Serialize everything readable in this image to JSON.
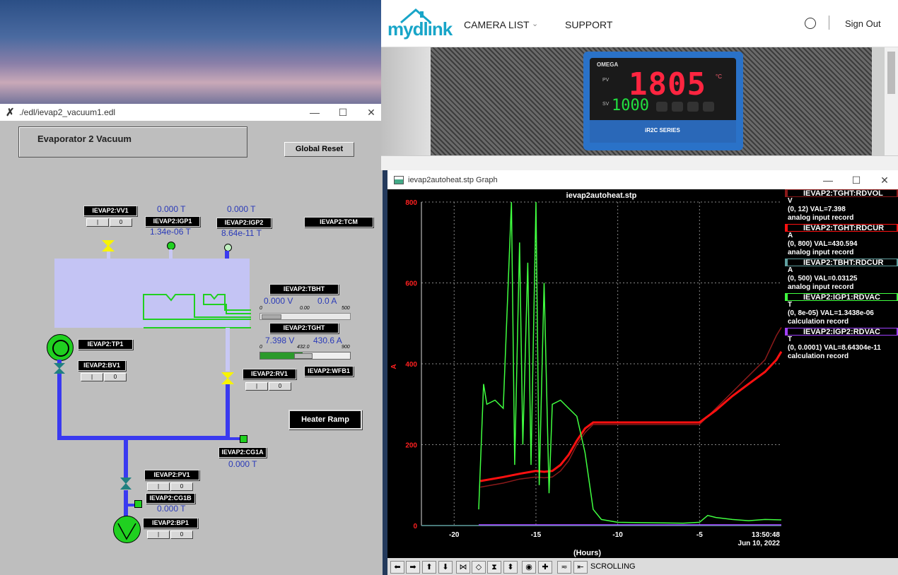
{
  "edm": {
    "title": "./edl/ievap2_vacuum1.edl",
    "panel_title": "Evaporator 2 Vacuum",
    "global_reset": "Global Reset",
    "heater_ramp": "Heater Ramp",
    "labels": {
      "vv1": "IEVAP2:VV1",
      "igp1": "IEVAP2:IGP1",
      "igp2": "IEVAP2:IGP2",
      "tcm": "IEVAP2:TCM",
      "tbht": "IEVAP2:TBHT",
      "tght": "IEVAP2:TGHT",
      "tp1": "IEVAP2:TP1",
      "bv1": "IEVAP2:BV1",
      "rv1": "IEVAP2:RV1",
      "wfb1": "IEVAP2:WFB1",
      "cg1a": "IEVAP2:CG1A",
      "pv1": "IEVAP2:PV1",
      "cg1b": "IEVAP2:CG1B",
      "bp1": "IEVAP2:BP1"
    },
    "values": {
      "igp1_t": "0.000 T",
      "igp1_p": "1.34e-06 T",
      "igp2_t": "0.000 T",
      "igp2_p": "8.64e-11 T",
      "tbht_v": "0.000 V",
      "tbht_a": "0.0 A",
      "tbht_min": "0",
      "tbht_mid": "0.00",
      "tbht_max": "500",
      "tght_v": "7.398 V",
      "tght_a": "430.6 A",
      "tght_min": "0",
      "tght_mid": "432.0",
      "tght_max": "900",
      "cg1a": "0.000 T",
      "cg1b": "0.000 T"
    },
    "button_pair": [
      "|",
      "0"
    ]
  },
  "mydlink": {
    "logo": "mydlink",
    "nav": [
      "CAMERA LIST",
      "SUPPORT"
    ],
    "sign_out": "Sign Out",
    "camera": {
      "brand": "OMEGA",
      "pv": "1805",
      "sv": "1000",
      "unit": "°C",
      "series": "iR2C SERIES",
      "pv_label": "PV",
      "sv_label": "SV"
    }
  },
  "graph": {
    "window_title": "ievap2autoheat.stp Graph",
    "plot_title": "ievap2autoheat.stp",
    "xlabel": "(Hours)",
    "ylabel": "A",
    "timestamp": "13:50:48",
    "date": "Jun 10, 2022",
    "status": "SCROLLING",
    "legend": [
      {
        "name": "IEVAP2:TGHT:RDVOL",
        "unit": "V",
        "range": "(0, 12) VAL=7.398",
        "desc": "analog input record",
        "color": "#8b1a1a"
      },
      {
        "name": "IEVAP2:TGHT:RDCUR",
        "unit": "A",
        "range": "(0, 800) VAL=430.594",
        "desc": "analog input record",
        "color": "#ff1010"
      },
      {
        "name": "IEVAP2:TBHT:RDCUR",
        "unit": "A",
        "range": "(0, 500) VAL=0.03125",
        "desc": "analog input record",
        "color": "#5fa0a0"
      },
      {
        "name": "IEVAP2:IGP1:RDVAC",
        "unit": "T",
        "range": "(0, 8e-05) VAL=1.3438e-06",
        "desc": "calculation record",
        "color": "#40ff40"
      },
      {
        "name": "IEVAP2:IGP2:RDVAC",
        "unit": "T",
        "range": "(0, 0.0001) VAL=8.64304e-11",
        "desc": "calculation record",
        "color": "#a040ff"
      }
    ]
  },
  "chart_data": {
    "type": "line",
    "title": "ievap2autoheat.stp",
    "xlabel": "(Hours)",
    "ylabel": "A",
    "xlim": [
      -22,
      0
    ],
    "ylim": [
      0,
      800
    ],
    "xticks": [
      -20,
      -15,
      -10,
      -5
    ],
    "yticks": [
      0,
      200,
      400,
      600,
      800
    ],
    "grid": true,
    "legend_position": "right",
    "series": [
      {
        "name": "IEVAP2:TGHT:RDVOL",
        "color": "#8b1a1a",
        "x": [
          -18.4,
          -17,
          -16,
          -15,
          -14.5,
          -14,
          -13.5,
          -13,
          -12.5,
          -12,
          -11.5,
          -10,
          -8,
          -6,
          -5,
          -4,
          -3,
          -2,
          -1,
          -0.3,
          0
        ],
        "y": [
          95,
          105,
          115,
          120,
          118,
          120,
          135,
          160,
          200,
          230,
          250,
          250,
          250,
          250,
          250,
          290,
          330,
          370,
          410,
          470,
          490
        ]
      },
      {
        "name": "IEVAP2:TGHT:RDCUR",
        "color": "#ff1010",
        "x": [
          -18.4,
          -17,
          -16,
          -15,
          -14.5,
          -14,
          -13.5,
          -13,
          -12.5,
          -12,
          -11.5,
          -10,
          -8,
          -6,
          -5,
          -4,
          -3,
          -2,
          -1,
          -0.3,
          0
        ],
        "y": [
          110,
          120,
          128,
          135,
          133,
          135,
          150,
          175,
          210,
          240,
          255,
          255,
          255,
          255,
          255,
          285,
          320,
          350,
          380,
          410,
          430
        ]
      },
      {
        "name": "IEVAP2:TBHT:RDCUR",
        "color": "#5fa0a0",
        "x": [
          -22,
          0
        ],
        "y": [
          0,
          0
        ]
      },
      {
        "name": "IEVAP2:IGP1:RDVAC",
        "color": "#40ff40",
        "x": [
          -18.5,
          -18.2,
          -18,
          -17.5,
          -17,
          -16.5,
          -16.3,
          -16,
          -15.8,
          -15.5,
          -15.3,
          -15,
          -14.8,
          -14.5,
          -14.2,
          -14,
          -13.5,
          -13,
          -12.5,
          -12,
          -11.5,
          -11,
          -10,
          -8,
          -6,
          -5,
          -4.5,
          -4,
          -3,
          -2,
          -1,
          0
        ],
        "y": [
          40,
          350,
          300,
          310,
          290,
          800,
          150,
          700,
          200,
          650,
          150,
          800,
          100,
          600,
          80,
          300,
          310,
          290,
          270,
          180,
          40,
          15,
          8,
          7,
          6,
          8,
          25,
          20,
          15,
          12,
          15,
          14
        ]
      },
      {
        "name": "IEVAP2:IGP2:RDVAC",
        "color": "#a040ff",
        "x": [
          -18.5,
          0
        ],
        "y": [
          2,
          2
        ]
      }
    ]
  }
}
